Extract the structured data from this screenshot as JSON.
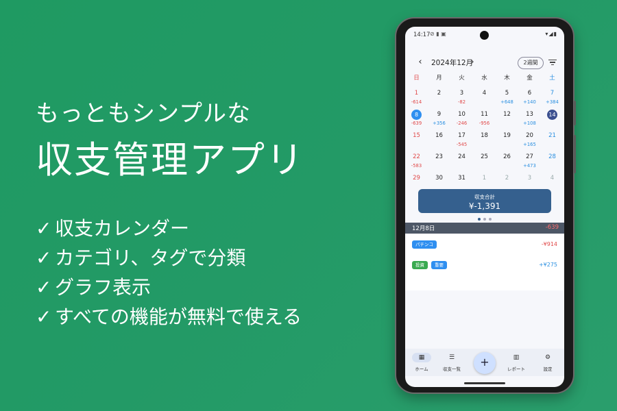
{
  "promo": {
    "tagline": "もっともシンプルな",
    "headline": "収支管理アプリ",
    "features": [
      "収支カレンダー",
      "カテゴリ、タグで分類",
      "グラフ表示",
      "すべての機能が無料で使える"
    ],
    "check": "✓"
  },
  "status": {
    "time": "14:17",
    "left_icons": "⊘ ▮ ▣",
    "right_icons": "▾◢▮"
  },
  "toolbar": {
    "prev": "‹",
    "next": "›",
    "month": "2024年12月",
    "range_chip": "2週間"
  },
  "calendar": {
    "weekdays": [
      "日",
      "月",
      "火",
      "水",
      "木",
      "金",
      "土"
    ],
    "weeks": [
      [
        {
          "d": "1",
          "a": "-614"
        },
        {
          "d": "2",
          "a": ""
        },
        {
          "d": "3",
          "a": "-82"
        },
        {
          "d": "4",
          "a": ""
        },
        {
          "d": "5",
          "a": "+648"
        },
        {
          "d": "6",
          "a": "+140"
        },
        {
          "d": "7",
          "a": "+384"
        }
      ],
      [
        {
          "d": "8",
          "a": "-639",
          "sel": "sel"
        },
        {
          "d": "9",
          "a": "+356"
        },
        {
          "d": "10",
          "a": "-246"
        },
        {
          "d": "11",
          "a": "-956"
        },
        {
          "d": "12",
          "a": ""
        },
        {
          "d": "13",
          "a": "+108"
        },
        {
          "d": "14",
          "a": "",
          "sel": "today"
        }
      ],
      [
        {
          "d": "15",
          "a": ""
        },
        {
          "d": "16",
          "a": ""
        },
        {
          "d": "17",
          "a": "-545"
        },
        {
          "d": "18",
          "a": ""
        },
        {
          "d": "19",
          "a": ""
        },
        {
          "d": "20",
          "a": "+165"
        },
        {
          "d": "21",
          "a": ""
        }
      ],
      [
        {
          "d": "22",
          "a": "-583"
        },
        {
          "d": "23",
          "a": ""
        },
        {
          "d": "24",
          "a": ""
        },
        {
          "d": "25",
          "a": ""
        },
        {
          "d": "26",
          "a": ""
        },
        {
          "d": "27",
          "a": "+473"
        },
        {
          "d": "28",
          "a": ""
        }
      ],
      [
        {
          "d": "29",
          "a": ""
        },
        {
          "d": "30",
          "a": ""
        },
        {
          "d": "31",
          "a": ""
        },
        {
          "d": "1",
          "a": "",
          "muted": true
        },
        {
          "d": "2",
          "a": "",
          "muted": true
        },
        {
          "d": "3",
          "a": "",
          "muted": true
        },
        {
          "d": "4",
          "a": "",
          "muted": true
        }
      ]
    ]
  },
  "summary": {
    "label": "収支合計",
    "value": "¥-1,391"
  },
  "day_detail": {
    "date": "12月8日",
    "total": "-639",
    "entries": [
      {
        "tags": [
          {
            "text": "パチンコ",
            "color": "blue"
          }
        ],
        "amount": "-¥914"
      },
      {
        "tags": [
          {
            "text": "投資",
            "color": "green"
          },
          {
            "text": "重要",
            "color": "blue"
          }
        ],
        "amount": "+¥275"
      }
    ]
  },
  "bottom_nav": {
    "home": "ホーム",
    "list": "収支一覧",
    "add": "+",
    "report": "レポート",
    "settings": "設定"
  },
  "colors": {
    "background": "#239a66",
    "summary_card": "#35608e",
    "selected_day": "#2f8ff0",
    "today": "#3b4f8f",
    "negative": "#e04848",
    "positive": "#2a8fe0",
    "day_header": "#4d5766"
  }
}
